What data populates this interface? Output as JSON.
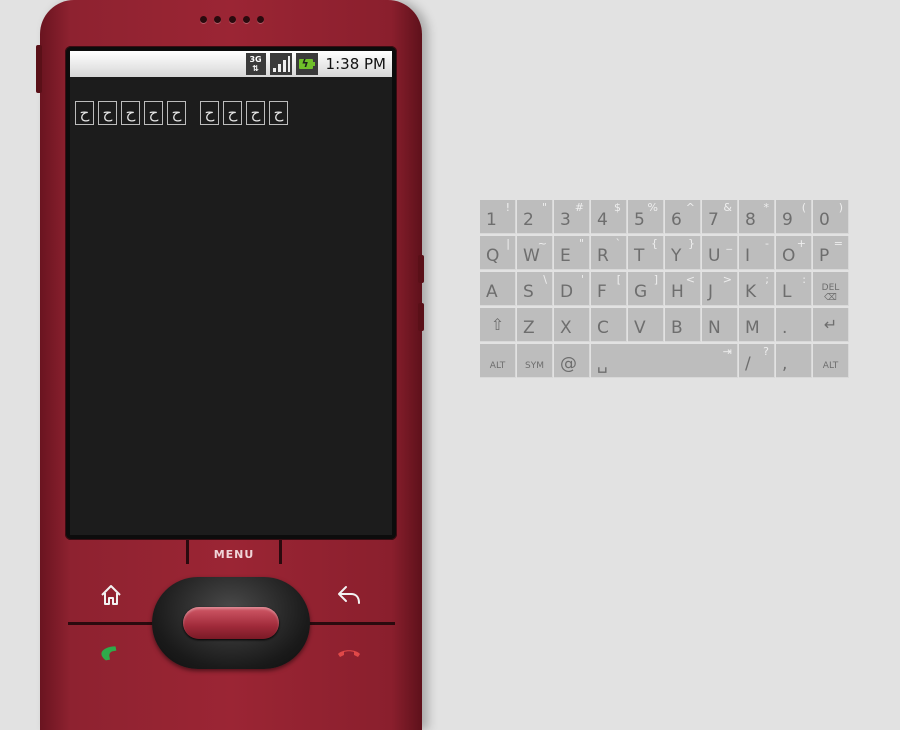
{
  "status_bar": {
    "network": "3G",
    "time": "1:38 PM"
  },
  "screen_text": {
    "group1": [
      "ح",
      "ح",
      "ح",
      "ح",
      "ح"
    ],
    "group2": [
      "ح",
      "ح",
      "ح",
      "ح"
    ]
  },
  "controls": {
    "menu_label": "MENU",
    "icons": [
      "home-icon",
      "back-icon",
      "call-icon",
      "end-call-icon"
    ]
  },
  "phone_color": "#9b2534",
  "keyboard": {
    "rows": [
      [
        {
          "main": "1",
          "alt": "!"
        },
        {
          "main": "2",
          "alt": "\""
        },
        {
          "main": "3",
          "alt": "#"
        },
        {
          "main": "4",
          "alt": "$"
        },
        {
          "main": "5",
          "alt": "%"
        },
        {
          "main": "6",
          "alt": "^"
        },
        {
          "main": "7",
          "alt": "&"
        },
        {
          "main": "8",
          "alt": "*"
        },
        {
          "main": "9",
          "alt": "("
        },
        {
          "main": "0",
          "alt": ")"
        }
      ],
      [
        {
          "main": "Q",
          "alt": "|"
        },
        {
          "main": "W",
          "alt": "~"
        },
        {
          "main": "E",
          "alt": "\""
        },
        {
          "main": "R",
          "alt": "`"
        },
        {
          "main": "T",
          "alt": "{"
        },
        {
          "main": "Y",
          "alt": "}"
        },
        {
          "main": "U",
          "alt": "_"
        },
        {
          "main": "I",
          "alt": "-"
        },
        {
          "main": "O",
          "alt": "+"
        },
        {
          "main": "P",
          "alt": "="
        }
      ],
      [
        {
          "main": "A",
          "alt": ""
        },
        {
          "main": "S",
          "alt": "\\"
        },
        {
          "main": "D",
          "alt": "'"
        },
        {
          "main": "F",
          "alt": "["
        },
        {
          "main": "G",
          "alt": "]"
        },
        {
          "main": "H",
          "alt": "<"
        },
        {
          "main": "J",
          "alt": ">"
        },
        {
          "main": "K",
          "alt": ";"
        },
        {
          "main": "L",
          "alt": ":"
        },
        {
          "main": "DEL",
          "alt": ""
        }
      ],
      [
        {
          "main": "⇧",
          "alt": ""
        },
        {
          "main": "Z",
          "alt": ""
        },
        {
          "main": "X",
          "alt": ""
        },
        {
          "main": "C",
          "alt": ""
        },
        {
          "main": "V",
          "alt": ""
        },
        {
          "main": "B",
          "alt": ""
        },
        {
          "main": "N",
          "alt": ""
        },
        {
          "main": "M",
          "alt": ""
        },
        {
          "main": ".",
          "alt": ""
        },
        {
          "main": "↵",
          "alt": ""
        }
      ],
      [
        {
          "main": "ALT",
          "alt": ""
        },
        {
          "main": "SYM",
          "alt": ""
        },
        {
          "main": "@",
          "alt": ""
        },
        {
          "main": "␣",
          "alt": "⇥"
        },
        {
          "main": "/",
          "alt": "?"
        },
        {
          "main": ",",
          "alt": ""
        },
        {
          "main": "ALT",
          "alt": ""
        }
      ]
    ]
  }
}
